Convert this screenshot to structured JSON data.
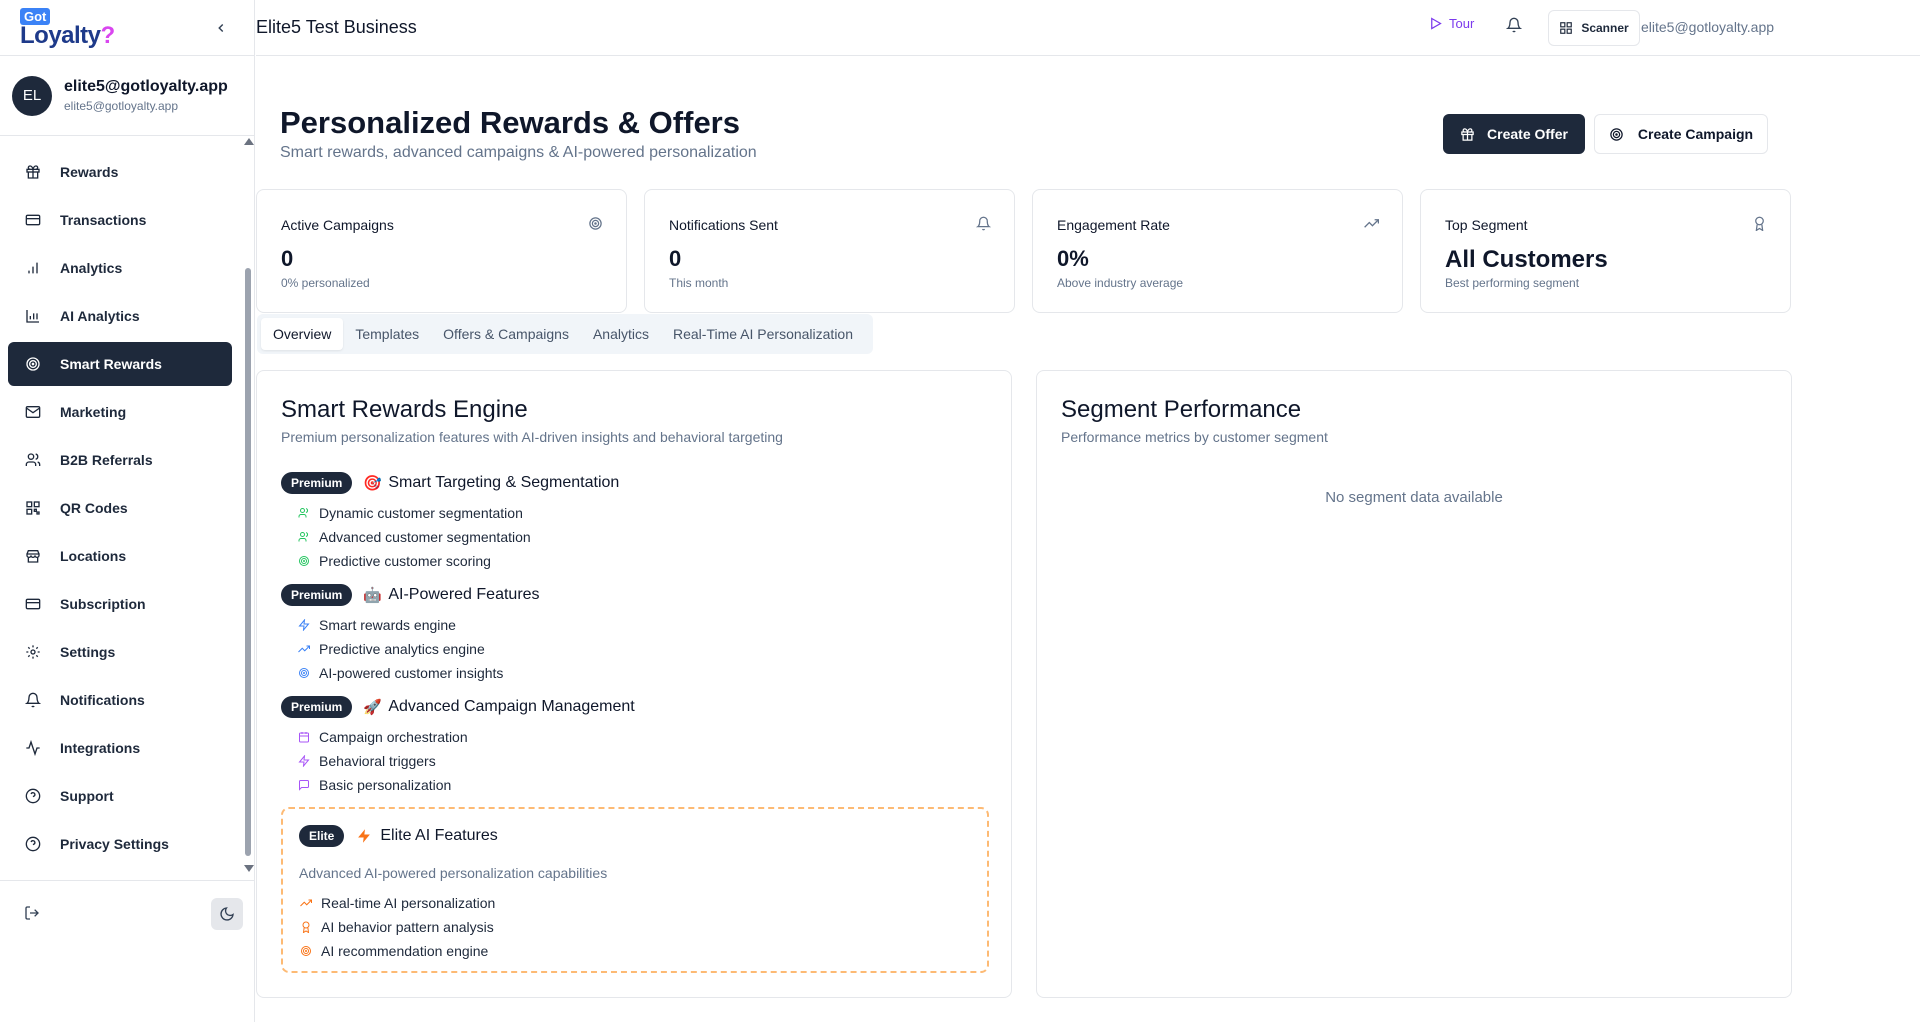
{
  "brand": {
    "logo_top": "Got",
    "logo_main": "Loyalty",
    "logo_mark": "?"
  },
  "profile": {
    "initials": "EL",
    "name": "elite5@gotloyalty.app",
    "email": "elite5@gotloyalty.app"
  },
  "nav": [
    {
      "label": "Rewards",
      "icon": "gift-icon"
    },
    {
      "label": "Transactions",
      "icon": "card-icon"
    },
    {
      "label": "Analytics",
      "icon": "bar-chart-icon"
    },
    {
      "label": "AI Analytics",
      "icon": "chart-icon"
    },
    {
      "label": "Smart Rewards",
      "icon": "target-icon",
      "active": true
    },
    {
      "label": "Marketing",
      "icon": "mail-icon"
    },
    {
      "label": "B2B Referrals",
      "icon": "users-icon"
    },
    {
      "label": "QR Codes",
      "icon": "qr-icon"
    },
    {
      "label": "Locations",
      "icon": "store-icon"
    },
    {
      "label": "Subscription",
      "icon": "card-icon"
    },
    {
      "label": "Settings",
      "icon": "gear-icon"
    },
    {
      "label": "Notifications",
      "icon": "bell-icon"
    },
    {
      "label": "Integrations",
      "icon": "activity-icon"
    },
    {
      "label": "Support",
      "icon": "help-icon"
    },
    {
      "label": "Privacy Settings",
      "icon": "help-icon"
    }
  ],
  "topbar": {
    "business": "Elite5 Test Business",
    "tour": "Tour",
    "scanner": "Scanner",
    "email": "elite5@gotloyalty.app"
  },
  "header": {
    "title": "Personalized Rewards & Offers",
    "subtitle": "Smart rewards, advanced campaigns & AI-powered personalization",
    "create_offer": "Create Offer",
    "create_campaign": "Create Campaign"
  },
  "stats": [
    {
      "label": "Active Campaigns",
      "value": "0",
      "sub": "0% personalized",
      "icon": "target-icon"
    },
    {
      "label": "Notifications Sent",
      "value": "0",
      "sub": "This month",
      "icon": "bell-icon"
    },
    {
      "label": "Engagement Rate",
      "value": "0%",
      "sub": "Above industry average",
      "icon": "trending-up-icon"
    },
    {
      "label": "Top Segment",
      "value": "All Customers",
      "sub": "Best performing segment",
      "icon": "award-icon"
    }
  ],
  "tabs": [
    "Overview",
    "Templates",
    "Offers & Campaigns",
    "Analytics",
    "Real-Time AI Personalization"
  ],
  "engine": {
    "title": "Smart Rewards Engine",
    "desc": "Premium personalization features with AI-driven insights and behavioral targeting",
    "groups": [
      {
        "badge": "Premium",
        "emoji": "🎯",
        "title": "Smart Targeting & Segmentation",
        "items": [
          "Dynamic customer segmentation",
          "Advanced customer segmentation",
          "Predictive customer scoring"
        ]
      },
      {
        "badge": "Premium",
        "emoji": "🤖",
        "title": "AI-Powered Features",
        "items": [
          "Smart rewards engine",
          "Predictive analytics engine",
          "AI-powered customer insights"
        ]
      },
      {
        "badge": "Premium",
        "emoji": "🚀",
        "title": "Advanced Campaign Management",
        "items": [
          "Campaign orchestration",
          "Behavioral triggers",
          "Basic personalization"
        ]
      }
    ],
    "elite": {
      "badge": "Elite",
      "title": "Elite AI Features",
      "desc": "Advanced AI-powered personalization capabilities",
      "items": [
        "Real-time AI personalization",
        "AI behavior pattern analysis",
        "AI recommendation engine"
      ]
    }
  },
  "segment": {
    "title": "Segment Performance",
    "desc": "Performance metrics by customer segment",
    "empty": "No segment data available"
  },
  "colors": {
    "primary": "#1e293b",
    "green": "#22c55e",
    "blue": "#3b82f6",
    "purple": "#a855f7",
    "orange": "#f97316"
  }
}
